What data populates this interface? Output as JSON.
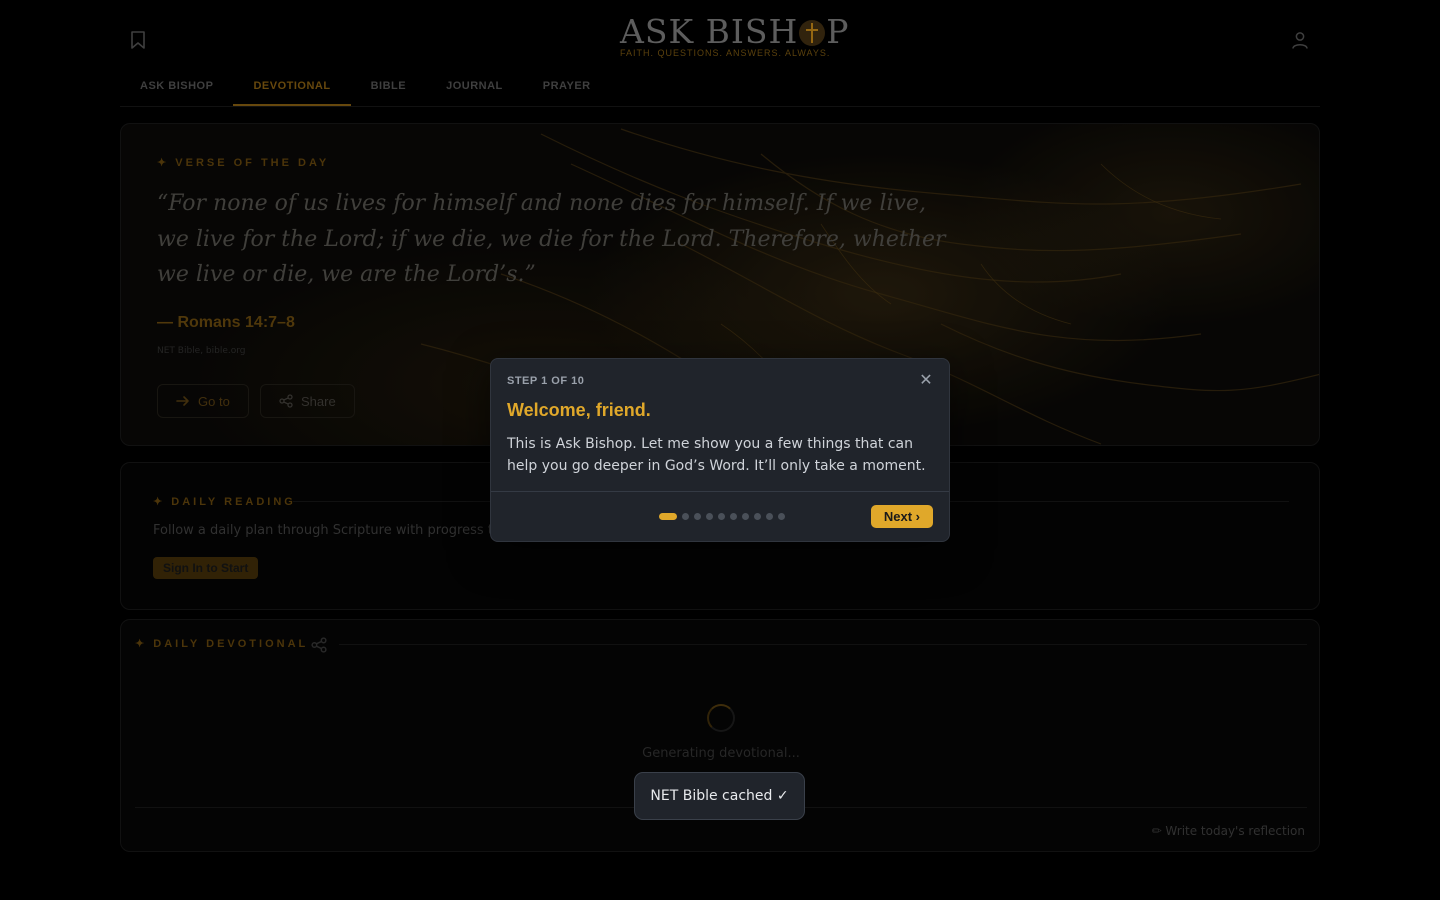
{
  "header": {
    "logo_title_left": "ASK BISH",
    "logo_title_right": "P",
    "logo_tagline": "FAITH. QUESTIONS. ANSWERS. ALWAYS.",
    "icons": {
      "bookmark": "bookmark-icon",
      "user": "user-icon",
      "logo_cross": "cross-icon"
    }
  },
  "tabs": [
    {
      "label": "ASK BISHOP",
      "active": false
    },
    {
      "label": "DEVOTIONAL",
      "active": true
    },
    {
      "label": "BIBLE",
      "active": false
    },
    {
      "label": "JOURNAL",
      "active": false
    },
    {
      "label": "PRAYER",
      "active": false
    }
  ],
  "verse": {
    "section_label": "✦ VERSE OF THE DAY",
    "text": "“For none of us lives for himself and none dies for himself. If we live, we live for the Lord; if we die, we die for the Lord. Therefore, whether we live or die, we are the Lord’s.”",
    "reference": "— Romans 14:7–8",
    "source": "NET Bible, bible.org",
    "goto_label": "Go to",
    "share_label": "Share"
  },
  "daily_reading": {
    "section_label": "✦ DAILY READING",
    "description": "Follow a daily plan through Scripture with progress tracking.",
    "signin_label": "Sign In to Start"
  },
  "daily_devotional": {
    "section_label": "✦ DAILY DEVOTIONAL",
    "loading_text": "Generating devotional...",
    "reflection_link": "✏ Write today's reflection"
  },
  "modal": {
    "step": "STEP 1 OF 10",
    "title": "Welcome, friend.",
    "body": "This is Ask Bishop. Let me show you a few things that can help you go deeper in God’s Word. It’ll only take a moment.",
    "next_label": "Next ›",
    "close_glyph": "✕",
    "total_steps": 10,
    "current_step": 1
  },
  "toast": {
    "text": "NET Bible cached ✓"
  },
  "colors": {
    "accent": "#e0a82a",
    "modal_bg": "#20242b",
    "page_bg": "#000000"
  }
}
